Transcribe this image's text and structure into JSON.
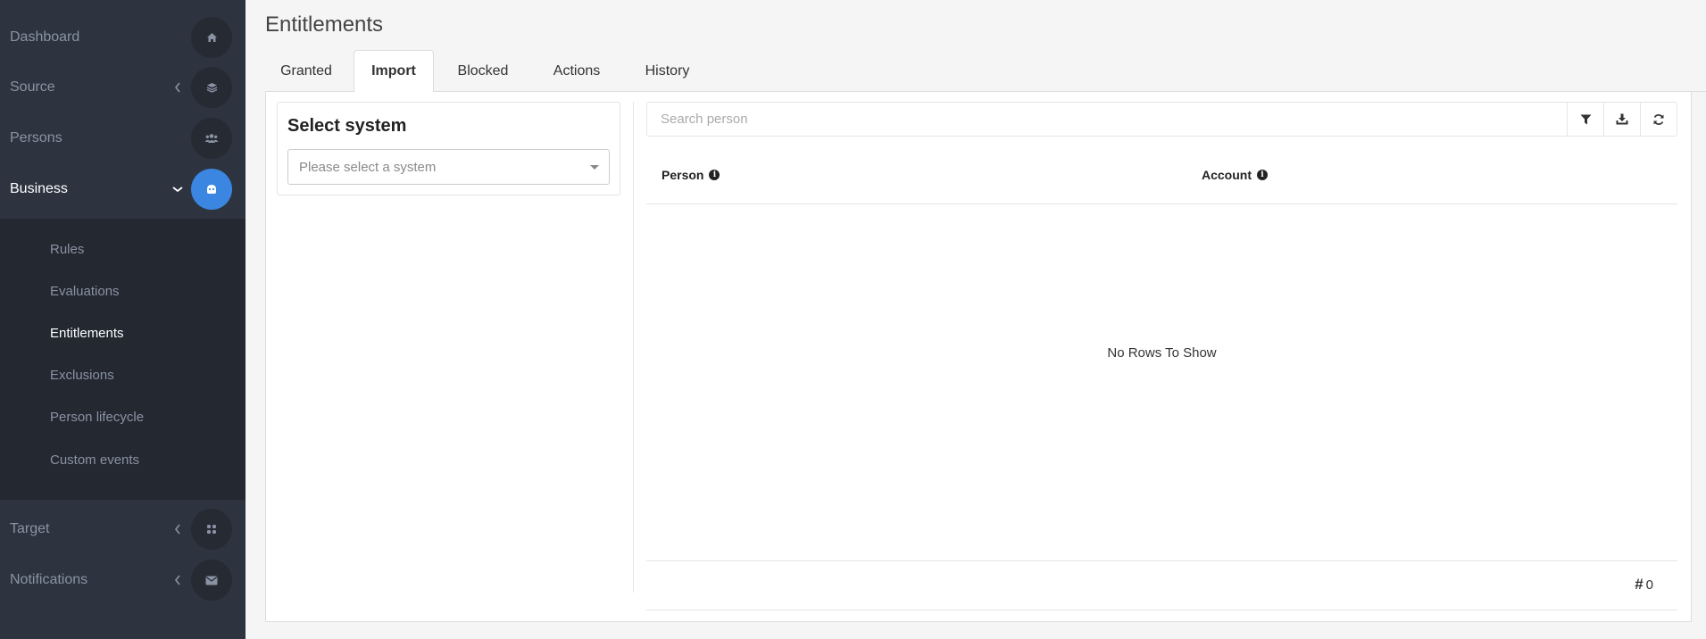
{
  "sidebar": {
    "items": [
      {
        "label": "Dashboard",
        "icon": "home-icon"
      },
      {
        "label": "Source",
        "icon": "layers-icon"
      },
      {
        "label": "Persons",
        "icon": "users-icon"
      },
      {
        "label": "Business",
        "icon": "business-icon"
      },
      {
        "label": "Target",
        "icon": "apps-icon"
      },
      {
        "label": "Notifications",
        "icon": "envelope-icon"
      }
    ],
    "submenu": [
      "Rules",
      "Evaluations",
      "Entitlements",
      "Exclusions",
      "Person lifecycle",
      "Custom events"
    ],
    "active_item": "Business",
    "active_subitem": "Entitlements"
  },
  "page": {
    "title": "Entitlements"
  },
  "tabs": [
    "Granted",
    "Import",
    "Blocked",
    "Actions",
    "History"
  ],
  "active_tab": "Import",
  "left_panel": {
    "heading": "Select system",
    "select_placeholder": "Please select a system"
  },
  "search": {
    "placeholder": "Search person"
  },
  "grid": {
    "columns": [
      "Person",
      "Account"
    ],
    "empty_message": "No Rows To Show",
    "count_symbol": "#",
    "count": "0"
  },
  "colors": {
    "sidebar_bg": "#2d3440",
    "submenu_bg": "#232831",
    "accent": "#3a86e0"
  }
}
